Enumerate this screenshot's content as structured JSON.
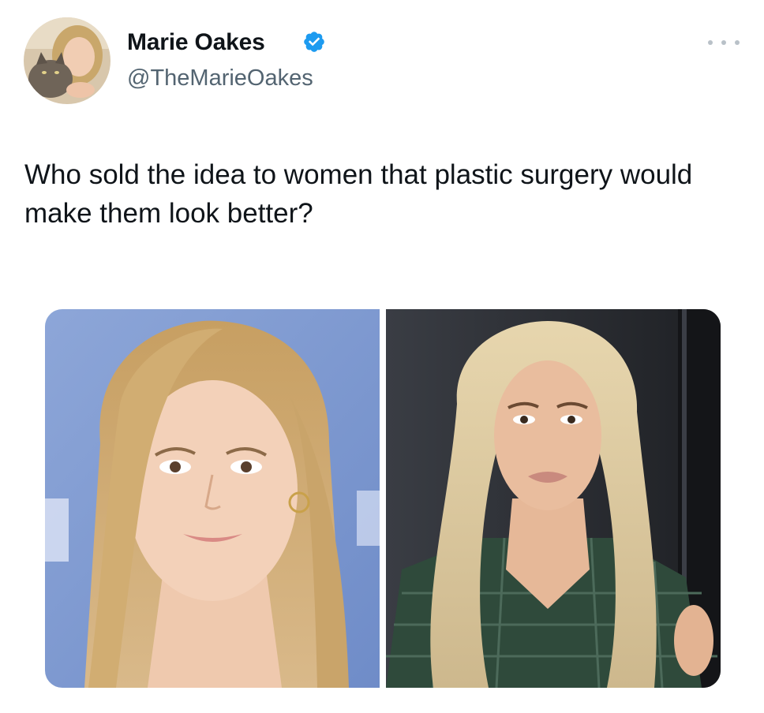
{
  "author": {
    "display_name": "Marie Oakes",
    "handle": "@TheMarieOakes",
    "verified": true,
    "avatar_icon": "profile-photo-with-cat"
  },
  "tweet": {
    "text": "Who sold the idea to women that plastic surgery would make them look better?"
  },
  "media": [
    {
      "description_icon": "portrait-photo-before"
    },
    {
      "description_icon": "portrait-photo-after"
    }
  ],
  "colors": {
    "text": "#0f1419",
    "secondary_text": "#536471",
    "verified_blue": "#1d9bf0",
    "more_dots": "#b9c1c8"
  }
}
